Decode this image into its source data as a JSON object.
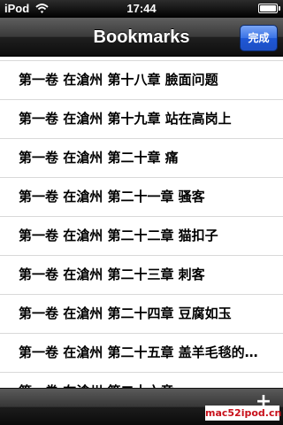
{
  "status_bar": {
    "carrier": "iPod",
    "time": "17:44",
    "wifi_icon": "wifi-icon",
    "battery_icon": "battery-icon"
  },
  "nav_bar": {
    "title": "Bookmarks",
    "done_label": "完成",
    "done_color": "#3a72e6"
  },
  "bookmarks": [
    "第一卷 在滄州 第十八章 臉面问题",
    "第一卷 在滄州 第十九章 站在高岗上",
    "第一卷 在滄州 第二十章 痛",
    "第一卷 在滄州 第二十一章 骚客",
    "第一卷 在滄州 第二十二章 猫扣子",
    "第一卷 在滄州 第二十三章 刺客",
    "第一卷 在滄州 第二十四章 豆腐如玉",
    "第一卷 在滄州 第二十五章 盖羊毛毯的…",
    "第一卷 在滄州 第二十六章 …"
  ],
  "toolbar": {
    "add_label": "+",
    "add_icon": "plus-icon",
    "watermark": "mac52ipod.cn"
  }
}
